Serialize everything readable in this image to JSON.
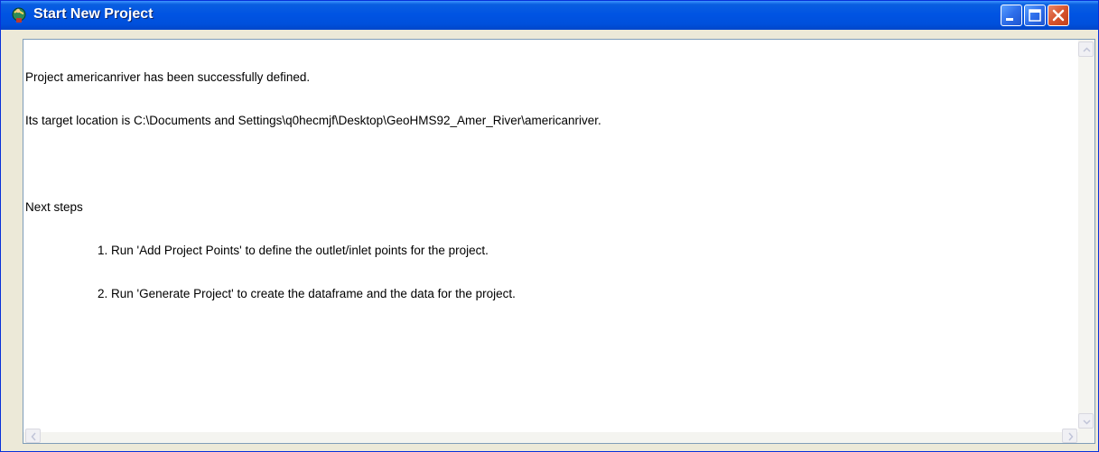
{
  "window": {
    "title": "Start New Project",
    "controls": {
      "minimize": "minimize",
      "maximize": "maximize",
      "close": "close"
    }
  },
  "message": {
    "line1": "Project americanriver has been successfully defined.",
    "line2": "Its target location is C:\\Documents and Settings\\q0hecmjf\\Desktop\\GeoHMS92_Amer_River\\americanriver.",
    "heading": "Next steps",
    "steps": [
      "1. Run 'Add Project Points' to define the outlet/inlet points for the project.",
      "2. Run 'Generate Project' to create the dataframe and the data for the project."
    ]
  },
  "colors": {
    "titlebar": "#0054e3",
    "frame": "#0831d9",
    "close_button": "#d6542e"
  },
  "icons": [
    "globe-person-icon",
    "minimize-icon",
    "maximize-icon",
    "close-icon",
    "scroll-up-arrow-icon",
    "scroll-down-arrow-icon",
    "scroll-left-arrow-icon",
    "scroll-right-arrow-icon"
  ]
}
